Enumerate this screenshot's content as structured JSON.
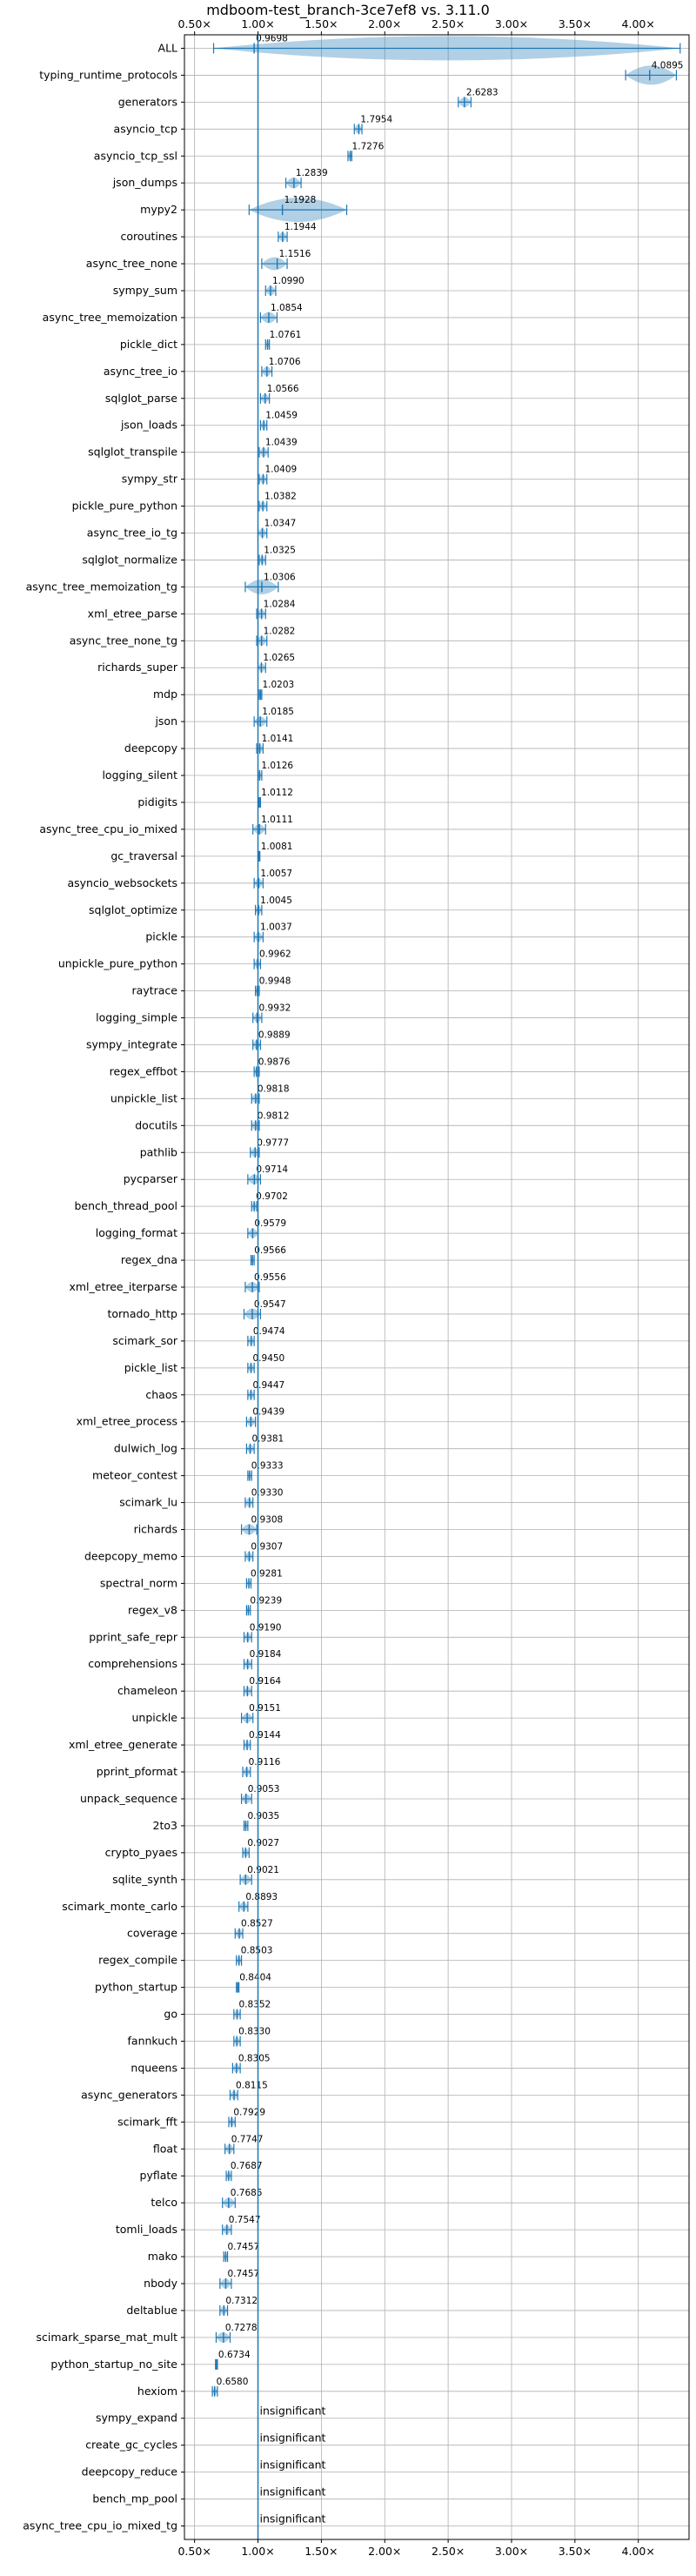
{
  "chart_data": {
    "type": "violin",
    "title": "mdboom-test_branch-3ce7ef8 vs. 3.11.0",
    "xlim": [
      0.42,
      4.4
    ],
    "xticks": [
      0.5,
      1.0,
      1.5,
      2.0,
      2.5,
      3.0,
      3.5,
      4.0
    ],
    "xtick_labels": [
      "0.50×",
      "1.00×",
      "1.50×",
      "2.00×",
      "2.50×",
      "3.00×",
      "3.50×",
      "4.00×"
    ],
    "ticks_top_and_bottom": true,
    "grid": true,
    "reference_line": 1.0,
    "colors": {
      "violin": "#1f77b4",
      "axis": "#000000",
      "grid": "#b0b0b0",
      "ref_line": "#1f77b4"
    },
    "benchmarks": [
      {
        "name": "ALL",
        "value": 0.9698,
        "label": "0.9698",
        "min": 0.65,
        "max": 4.33
      },
      {
        "name": "typing_runtime_protocols",
        "value": 4.0895,
        "label": "4.0895",
        "min": 3.9,
        "max": 4.3
      },
      {
        "name": "generators",
        "value": 2.6283,
        "label": "2.6283",
        "min": 2.58,
        "max": 2.68
      },
      {
        "name": "asyncio_tcp",
        "value": 1.7954,
        "label": "1.7954",
        "min": 1.76,
        "max": 1.82
      },
      {
        "name": "asyncio_tcp_ssl",
        "value": 1.7276,
        "label": "1.7276",
        "min": 1.71,
        "max": 1.74
      },
      {
        "name": "json_dumps",
        "value": 1.2839,
        "label": "1.2839",
        "min": 1.22,
        "max": 1.34
      },
      {
        "name": "mypy2",
        "value": 1.1928,
        "label": "1.1928",
        "min": 0.93,
        "max": 1.7
      },
      {
        "name": "coroutines",
        "value": 1.1944,
        "label": "1.1944",
        "min": 1.16,
        "max": 1.23
      },
      {
        "name": "async_tree_none",
        "value": 1.1516,
        "label": "1.1516",
        "min": 1.03,
        "max": 1.23
      },
      {
        "name": "sympy_sum",
        "value": 1.099,
        "label": "1.0990",
        "min": 1.06,
        "max": 1.14
      },
      {
        "name": "async_tree_memoization",
        "value": 1.0854,
        "label": "1.0854",
        "min": 1.02,
        "max": 1.15
      },
      {
        "name": "pickle_dict",
        "value": 1.0761,
        "label": "1.0761",
        "min": 1.06,
        "max": 1.09
      },
      {
        "name": "async_tree_io",
        "value": 1.0706,
        "label": "1.0706",
        "min": 1.03,
        "max": 1.11
      },
      {
        "name": "sqlglot_parse",
        "value": 1.0566,
        "label": "1.0566",
        "min": 1.02,
        "max": 1.09
      },
      {
        "name": "json_loads",
        "value": 1.0459,
        "label": "1.0459",
        "min": 1.02,
        "max": 1.07
      },
      {
        "name": "sqlglot_transpile",
        "value": 1.0439,
        "label": "1.0439",
        "min": 1.01,
        "max": 1.08
      },
      {
        "name": "sympy_str",
        "value": 1.0409,
        "label": "1.0409",
        "min": 1.01,
        "max": 1.07
      },
      {
        "name": "pickle_pure_python",
        "value": 1.0382,
        "label": "1.0382",
        "min": 1.01,
        "max": 1.07
      },
      {
        "name": "async_tree_io_tg",
        "value": 1.0347,
        "label": "1.0347",
        "min": 1.0,
        "max": 1.07
      },
      {
        "name": "sqlglot_normalize",
        "value": 1.0325,
        "label": "1.0325",
        "min": 1.01,
        "max": 1.06
      },
      {
        "name": "async_tree_memoization_tg",
        "value": 1.0306,
        "label": "1.0306",
        "min": 0.9,
        "max": 1.16
      },
      {
        "name": "xml_etree_parse",
        "value": 1.0284,
        "label": "1.0284",
        "min": 0.99,
        "max": 1.06
      },
      {
        "name": "async_tree_none_tg",
        "value": 1.0282,
        "label": "1.0282",
        "min": 0.99,
        "max": 1.07
      },
      {
        "name": "richards_super",
        "value": 1.0265,
        "label": "1.0265",
        "min": 1.0,
        "max": 1.06
      },
      {
        "name": "mdp",
        "value": 1.0203,
        "label": "1.0203",
        "min": 1.01,
        "max": 1.03
      },
      {
        "name": "json",
        "value": 1.0185,
        "label": "1.0185",
        "min": 0.97,
        "max": 1.07
      },
      {
        "name": "deepcopy",
        "value": 1.0141,
        "label": "1.0141",
        "min": 0.99,
        "max": 1.04
      },
      {
        "name": "logging_silent",
        "value": 1.0126,
        "label": "1.0126",
        "min": 1.0,
        "max": 1.03
      },
      {
        "name": "pidigits",
        "value": 1.0112,
        "label": "1.0112",
        "min": 1.005,
        "max": 1.02
      },
      {
        "name": "async_tree_cpu_io_mixed",
        "value": 1.0111,
        "label": "1.0111",
        "min": 0.96,
        "max": 1.06
      },
      {
        "name": "gc_traversal",
        "value": 1.0081,
        "label": "1.0081",
        "min": 1.0,
        "max": 1.015
      },
      {
        "name": "asyncio_websockets",
        "value": 1.0057,
        "label": "1.0057",
        "min": 0.97,
        "max": 1.04
      },
      {
        "name": "sqlglot_optimize",
        "value": 1.0045,
        "label": "1.0045",
        "min": 0.98,
        "max": 1.03
      },
      {
        "name": "pickle",
        "value": 1.0037,
        "label": "1.0037",
        "min": 0.97,
        "max": 1.04
      },
      {
        "name": "unpickle_pure_python",
        "value": 0.9962,
        "label": "0.9962",
        "min": 0.97,
        "max": 1.02
      },
      {
        "name": "raytrace",
        "value": 0.9948,
        "label": "0.9948",
        "min": 0.98,
        "max": 1.01
      },
      {
        "name": "logging_simple",
        "value": 0.9932,
        "label": "0.9932",
        "min": 0.96,
        "max": 1.03
      },
      {
        "name": "sympy_integrate",
        "value": 0.9889,
        "label": "0.9889",
        "min": 0.96,
        "max": 1.02
      },
      {
        "name": "regex_effbot",
        "value": 0.9876,
        "label": "0.9876",
        "min": 0.97,
        "max": 1.01
      },
      {
        "name": "unpickle_list",
        "value": 0.9818,
        "label": "0.9818",
        "min": 0.95,
        "max": 1.01
      },
      {
        "name": "docutils",
        "value": 0.9812,
        "label": "0.9812",
        "min": 0.95,
        "max": 1.01
      },
      {
        "name": "pathlib",
        "value": 0.9777,
        "label": "0.9777",
        "min": 0.94,
        "max": 1.01
      },
      {
        "name": "pycparser",
        "value": 0.9714,
        "label": "0.9714",
        "min": 0.92,
        "max": 1.02
      },
      {
        "name": "bench_thread_pool",
        "value": 0.9702,
        "label": "0.9702",
        "min": 0.95,
        "max": 0.99
      },
      {
        "name": "logging_format",
        "value": 0.9579,
        "label": "0.9579",
        "min": 0.92,
        "max": 1.0
      },
      {
        "name": "regex_dna",
        "value": 0.9566,
        "label": "0.9566",
        "min": 0.945,
        "max": 0.97
      },
      {
        "name": "xml_etree_iterparse",
        "value": 0.9556,
        "label": "0.9556",
        "min": 0.9,
        "max": 1.01
      },
      {
        "name": "tornado_http",
        "value": 0.9547,
        "label": "0.9547",
        "min": 0.89,
        "max": 1.02
      },
      {
        "name": "scimark_sor",
        "value": 0.9474,
        "label": "0.9474",
        "min": 0.92,
        "max": 0.97
      },
      {
        "name": "pickle_list",
        "value": 0.945,
        "label": "0.9450",
        "min": 0.92,
        "max": 0.97
      },
      {
        "name": "chaos",
        "value": 0.9447,
        "label": "0.9447",
        "min": 0.92,
        "max": 0.97
      },
      {
        "name": "xml_etree_process",
        "value": 0.9439,
        "label": "0.9439",
        "min": 0.91,
        "max": 0.98
      },
      {
        "name": "dulwich_log",
        "value": 0.9381,
        "label": "0.9381",
        "min": 0.91,
        "max": 0.97
      },
      {
        "name": "meteor_contest",
        "value": 0.9333,
        "label": "0.9333",
        "min": 0.92,
        "max": 0.95
      },
      {
        "name": "scimark_lu",
        "value": 0.933,
        "label": "0.9330",
        "min": 0.9,
        "max": 0.96
      },
      {
        "name": "richards",
        "value": 0.9308,
        "label": "0.9308",
        "min": 0.87,
        "max": 0.99
      },
      {
        "name": "deepcopy_memo",
        "value": 0.9307,
        "label": "0.9307",
        "min": 0.9,
        "max": 0.96
      },
      {
        "name": "spectral_norm",
        "value": 0.9281,
        "label": "0.9281",
        "min": 0.91,
        "max": 0.945
      },
      {
        "name": "regex_v8",
        "value": 0.9239,
        "label": "0.9239",
        "min": 0.91,
        "max": 0.94
      },
      {
        "name": "pprint_safe_repr",
        "value": 0.919,
        "label": "0.9190",
        "min": 0.89,
        "max": 0.95
      },
      {
        "name": "comprehensions",
        "value": 0.9184,
        "label": "0.9184",
        "min": 0.89,
        "max": 0.95
      },
      {
        "name": "chameleon",
        "value": 0.9164,
        "label": "0.9164",
        "min": 0.89,
        "max": 0.95
      },
      {
        "name": "unpickle",
        "value": 0.9151,
        "label": "0.9151",
        "min": 0.87,
        "max": 0.96
      },
      {
        "name": "xml_etree_generate",
        "value": 0.9144,
        "label": "0.9144",
        "min": 0.89,
        "max": 0.94
      },
      {
        "name": "pprint_pformat",
        "value": 0.9116,
        "label": "0.9116",
        "min": 0.88,
        "max": 0.94
      },
      {
        "name": "unpack_sequence",
        "value": 0.9053,
        "label": "0.9053",
        "min": 0.87,
        "max": 0.95
      },
      {
        "name": "2to3",
        "value": 0.9035,
        "label": "0.9035",
        "min": 0.89,
        "max": 0.92
      },
      {
        "name": "crypto_pyaes",
        "value": 0.9027,
        "label": "0.9027",
        "min": 0.88,
        "max": 0.93
      },
      {
        "name": "sqlite_synth",
        "value": 0.9021,
        "label": "0.9021",
        "min": 0.86,
        "max": 0.95
      },
      {
        "name": "scimark_monte_carlo",
        "value": 0.8893,
        "label": "0.8893",
        "min": 0.85,
        "max": 0.92
      },
      {
        "name": "coverage",
        "value": 0.8527,
        "label": "0.8527",
        "min": 0.82,
        "max": 0.88
      },
      {
        "name": "regex_compile",
        "value": 0.8503,
        "label": "0.8503",
        "min": 0.83,
        "max": 0.87
      },
      {
        "name": "python_startup",
        "value": 0.8404,
        "label": "0.8404",
        "min": 0.83,
        "max": 0.85
      },
      {
        "name": "go",
        "value": 0.8352,
        "label": "0.8352",
        "min": 0.81,
        "max": 0.86
      },
      {
        "name": "fannkuch",
        "value": 0.833,
        "label": "0.8330",
        "min": 0.81,
        "max": 0.86
      },
      {
        "name": "nqueens",
        "value": 0.8305,
        "label": "0.8305",
        "min": 0.8,
        "max": 0.86
      },
      {
        "name": "async_generators",
        "value": 0.8115,
        "label": "0.8115",
        "min": 0.78,
        "max": 0.84
      },
      {
        "name": "scimark_fft",
        "value": 0.7929,
        "label": "0.7929",
        "min": 0.77,
        "max": 0.82
      },
      {
        "name": "float",
        "value": 0.7747,
        "label": "0.7747",
        "min": 0.74,
        "max": 0.81
      },
      {
        "name": "pyflate",
        "value": 0.7687,
        "label": "0.7687",
        "min": 0.75,
        "max": 0.79
      },
      {
        "name": "telco",
        "value": 0.7685,
        "label": "0.7685",
        "min": 0.72,
        "max": 0.82
      },
      {
        "name": "tomli_loads",
        "value": 0.7547,
        "label": "0.7547",
        "min": 0.72,
        "max": 0.79
      },
      {
        "name": "mako",
        "value": 0.7457,
        "label": "0.7457",
        "min": 0.73,
        "max": 0.76
      },
      {
        "name": "nbody",
        "value": 0.7457,
        "label": "0.7457",
        "min": 0.7,
        "max": 0.79
      },
      {
        "name": "deltablue",
        "value": 0.7312,
        "label": "0.7312",
        "min": 0.7,
        "max": 0.76
      },
      {
        "name": "scimark_sparse_mat_mult",
        "value": 0.7278,
        "label": "0.7278",
        "min": 0.67,
        "max": 0.78
      },
      {
        "name": "python_startup_no_site",
        "value": 0.6734,
        "label": "0.6734",
        "min": 0.665,
        "max": 0.68
      },
      {
        "name": "hexiom",
        "value": 0.658,
        "label": "0.6580",
        "min": 0.64,
        "max": 0.68
      },
      {
        "name": "sympy_expand",
        "value": null,
        "label": "insignificant"
      },
      {
        "name": "create_gc_cycles",
        "value": null,
        "label": "insignificant"
      },
      {
        "name": "deepcopy_reduce",
        "value": null,
        "label": "insignificant"
      },
      {
        "name": "bench_mp_pool",
        "value": null,
        "label": "insignificant"
      },
      {
        "name": "async_tree_cpu_io_mixed_tg",
        "value": null,
        "label": "insignificant"
      }
    ]
  }
}
